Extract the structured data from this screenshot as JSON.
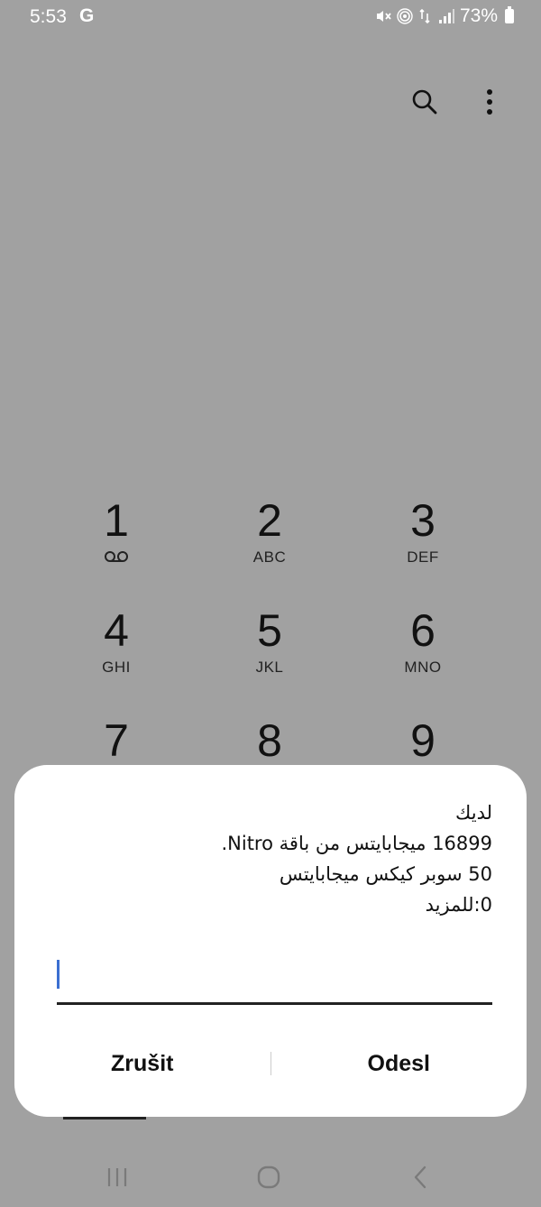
{
  "status_bar": {
    "time": "5:53",
    "g_label": "G",
    "battery": "73%"
  },
  "toolbar": {
    "search_icon": "search-icon",
    "more_icon": "more-vert-icon"
  },
  "keypad": [
    {
      "digit": "1",
      "letters": ""
    },
    {
      "digit": "2",
      "letters": "ABC"
    },
    {
      "digit": "3",
      "letters": "DEF"
    },
    {
      "digit": "4",
      "letters": "GHI"
    },
    {
      "digit": "5",
      "letters": "JKL"
    },
    {
      "digit": "6",
      "letters": "MNO"
    },
    {
      "digit": "7",
      "letters": ""
    },
    {
      "digit": "8",
      "letters": ""
    },
    {
      "digit": "9",
      "letters": ""
    }
  ],
  "dialog": {
    "lines": [
      "لديك",
      "16899 ميجابايتس من باقة Nitro.",
      "50  سوبر كيكس ميجابايتس",
      "0:للمزيد"
    ],
    "input_value": "",
    "cancel_label": "Zrušit",
    "send_label": "Odesl"
  },
  "nav_bar": {
    "recents_icon": "recents-icon",
    "home_icon": "home-icon",
    "back_icon": "back-icon"
  },
  "colors": {
    "background": "#a1a1a1",
    "caret": "#3b6fd1"
  }
}
